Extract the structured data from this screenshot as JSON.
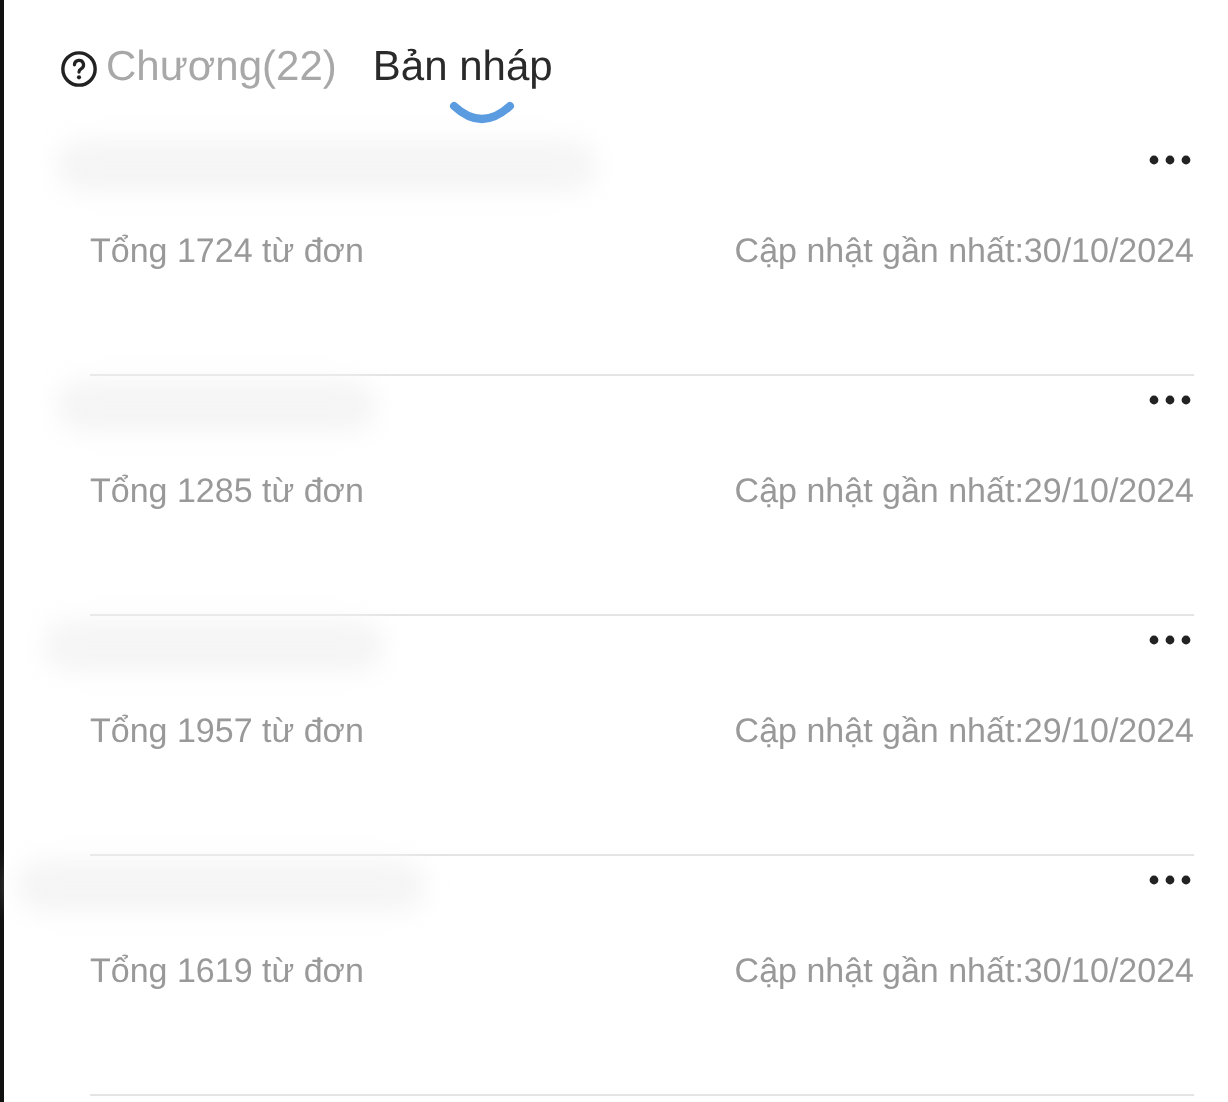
{
  "tabs": [
    {
      "label": "Chương(22)",
      "selected": false
    },
    {
      "label": "Bản nháp",
      "selected": true
    }
  ],
  "drafts": [
    {
      "words": "Tổng 1724 từ đơn",
      "updated": "Cập nhật gần nhất:30/10/2024"
    },
    {
      "words": "Tổng 1285 từ đơn",
      "updated": "Cập nhật gần nhất:29/10/2024"
    },
    {
      "words": "Tổng 1957 từ đơn",
      "updated": "Cập nhật gần nhất:29/10/2024"
    },
    {
      "words": "Tổng 1619 từ đơn",
      "updated": "Cập nhật gần nhất:30/10/2024"
    }
  ]
}
